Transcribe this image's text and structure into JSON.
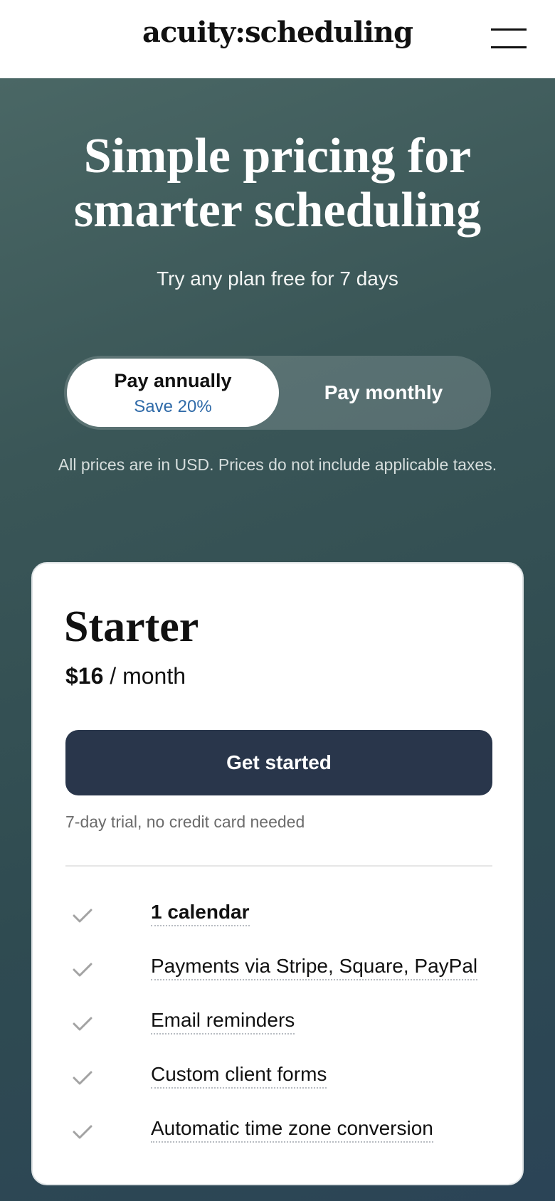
{
  "header": {
    "logo_text": "acuity:scheduling",
    "menu_icon": "hamburger-menu-icon"
  },
  "hero": {
    "title": "Simple pricing for smarter scheduling",
    "subtitle": "Try any plan free for 7 days"
  },
  "billing_toggle": {
    "annual_label": "Pay annually",
    "annual_badge": "Save 20%",
    "monthly_label": "Pay monthly",
    "selected": "annual"
  },
  "price_note": "All prices are in USD. Prices do not include applicable taxes.",
  "plan": {
    "name": "Starter",
    "price_amount": "$16",
    "price_period": "/ month",
    "cta_label": "Get started",
    "trial_note": "7-day trial, no credit card needed",
    "features": [
      {
        "label": "1 calendar",
        "bold": true,
        "icon": "check-icon"
      },
      {
        "label": "Payments via Stripe, Square, PayPal",
        "bold": false,
        "icon": "check-icon"
      },
      {
        "label": "Email reminders",
        "bold": false,
        "icon": "check-icon"
      },
      {
        "label": "Custom client forms",
        "bold": false,
        "icon": "check-icon"
      },
      {
        "label": "Automatic time zone conversion",
        "bold": false,
        "icon": "check-icon"
      }
    ]
  },
  "colors": {
    "cta_background": "#29364b",
    "save_badge": "#2f6aa8",
    "hero_background": "#3a5657"
  }
}
